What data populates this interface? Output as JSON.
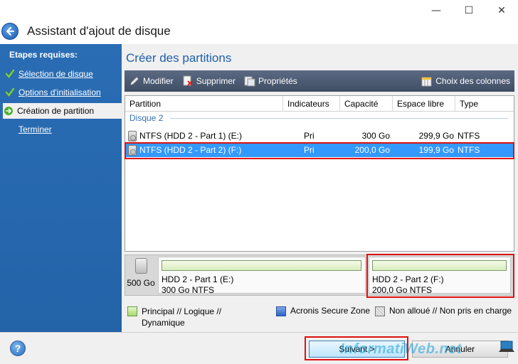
{
  "window": {
    "title": "Assistant d'ajout de disque",
    "controls": [
      "minimize",
      "maximize",
      "close"
    ]
  },
  "sidebar": {
    "heading": "Etapes requises:",
    "steps": [
      {
        "label": "Sélection de disque",
        "status": "done"
      },
      {
        "label": "Options d'initialisation",
        "status": "done"
      },
      {
        "label": "Création de partition",
        "status": "current"
      },
      {
        "label": "Terminer",
        "status": "pending"
      }
    ]
  },
  "main": {
    "title": "Créer des partitions",
    "toolbar": {
      "modify": "Modifier",
      "delete": "Supprimer",
      "properties": "Propriétés",
      "columns": "Choix des colonnes"
    },
    "columns": [
      "Partition",
      "Indicateurs",
      "Capacité",
      "Espace libre",
      "Type"
    ],
    "group": "Disque 2",
    "rows": [
      {
        "partition": "NTFS (HDD 2 - Part 1) (E:)",
        "flags": "Pri",
        "capacity": "300 Go",
        "free": "299,9 Go",
        "type": "NTFS",
        "selected": false
      },
      {
        "partition": "NTFS (HDD 2 - Part 2) (F:)",
        "flags": "Pri",
        "capacity": "200,0 Go",
        "free": "199,9 Go",
        "type": "NTFS",
        "selected": true
      }
    ],
    "disk_map": {
      "disk_size": "500 Go",
      "parts": [
        {
          "name": "HDD 2 - Part 1 (E:)",
          "info": "300 Go  NTFS"
        },
        {
          "name": "HDD 2 - Part 2 (F:)",
          "info": "200,0 Go  NTFS"
        }
      ]
    },
    "legend": {
      "primary": "Principal // Logique // Dynamique",
      "acronis": "Acronis Secure Zone",
      "unallocated": "Non alloué // Non pris en charge"
    }
  },
  "footer": {
    "next": "Suivant >",
    "cancel": "Annuler",
    "watermark": "InformatiWeb.net"
  },
  "colors": {
    "sidebar": "#2a6db4",
    "selection": "#3399ff",
    "title_blue": "#1e5fa8",
    "highlight": "#e01010"
  }
}
